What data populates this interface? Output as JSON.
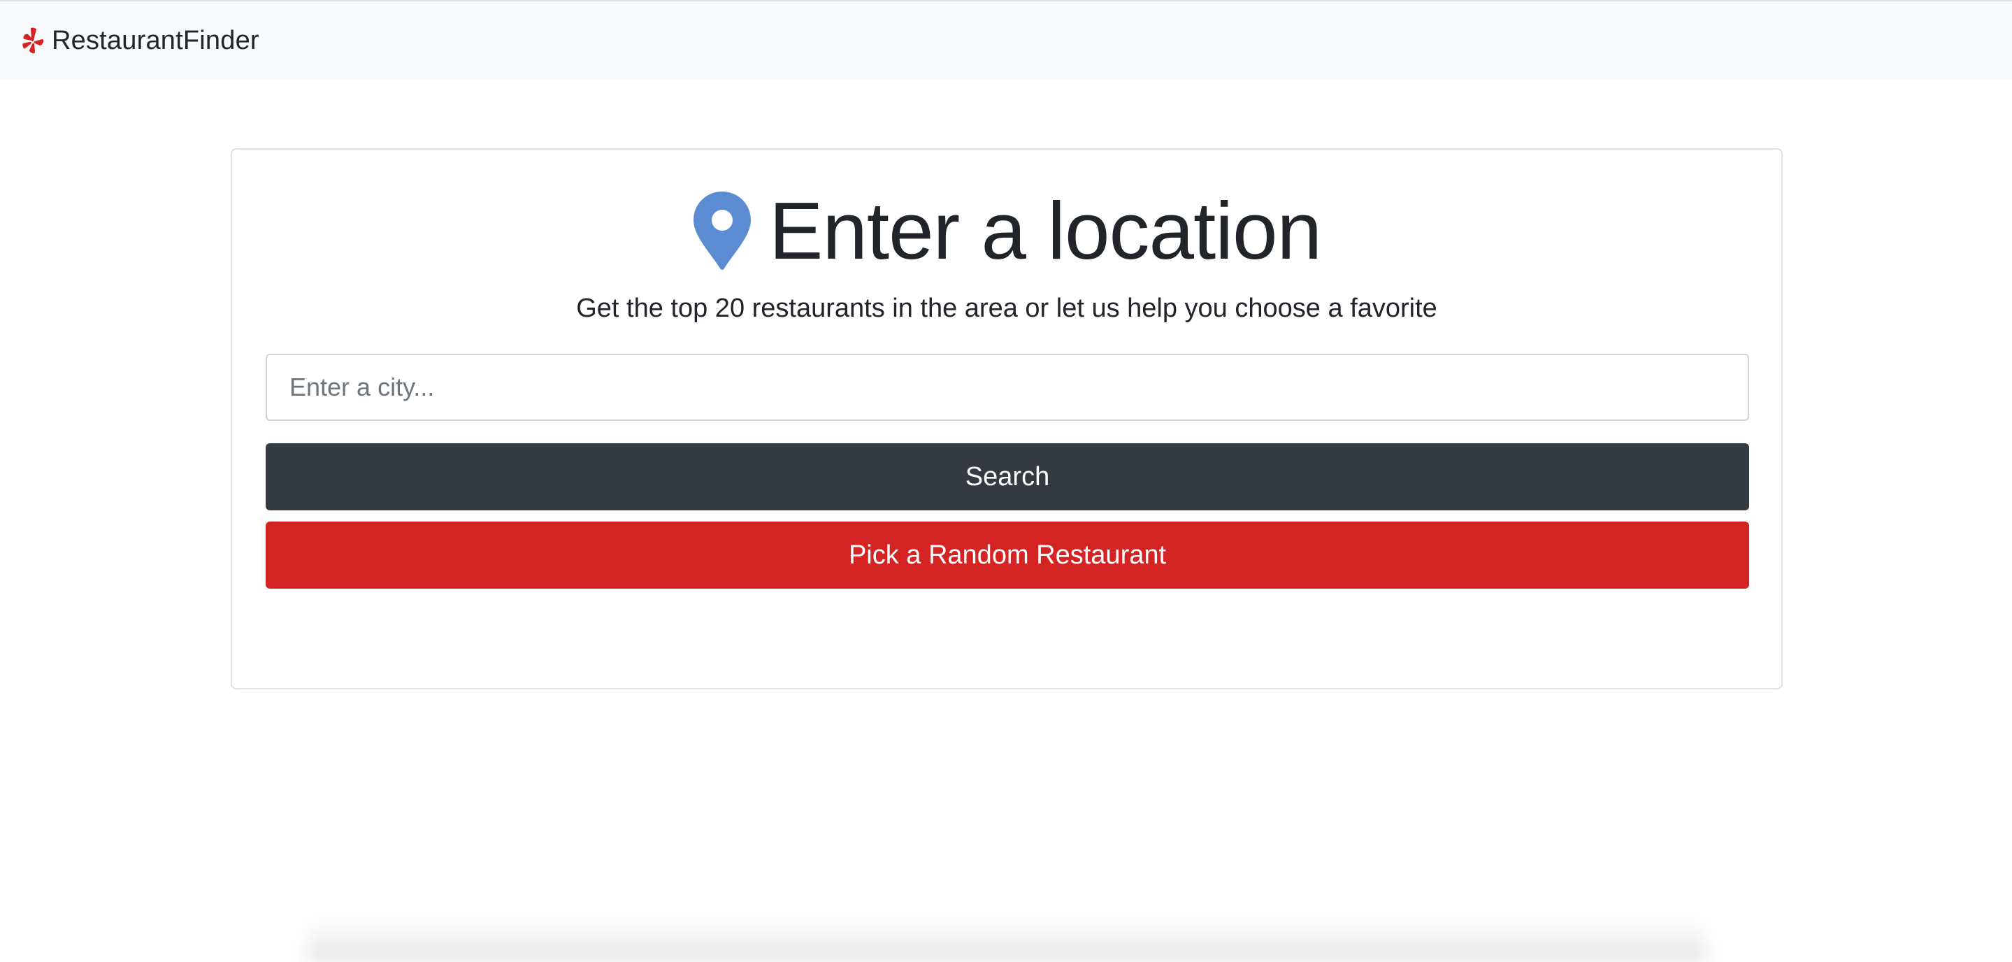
{
  "navbar": {
    "brand_icon": "yelp-burst-icon",
    "brand_text": "RestaurantFinder",
    "brand_color": "#d32323"
  },
  "main": {
    "heading_icon": "map-pin-icon",
    "heading_icon_color": "#5b8bd0",
    "title": "Enter a location",
    "subtitle": "Get the top 20 restaurants in the area or let us help you choose a favorite",
    "city_input": {
      "value": "",
      "placeholder": "Enter a city..."
    },
    "search_button": {
      "label": "Search",
      "color": "#343a40"
    },
    "random_button": {
      "label": "Pick a Random Restaurant",
      "color": "#d32323"
    }
  }
}
